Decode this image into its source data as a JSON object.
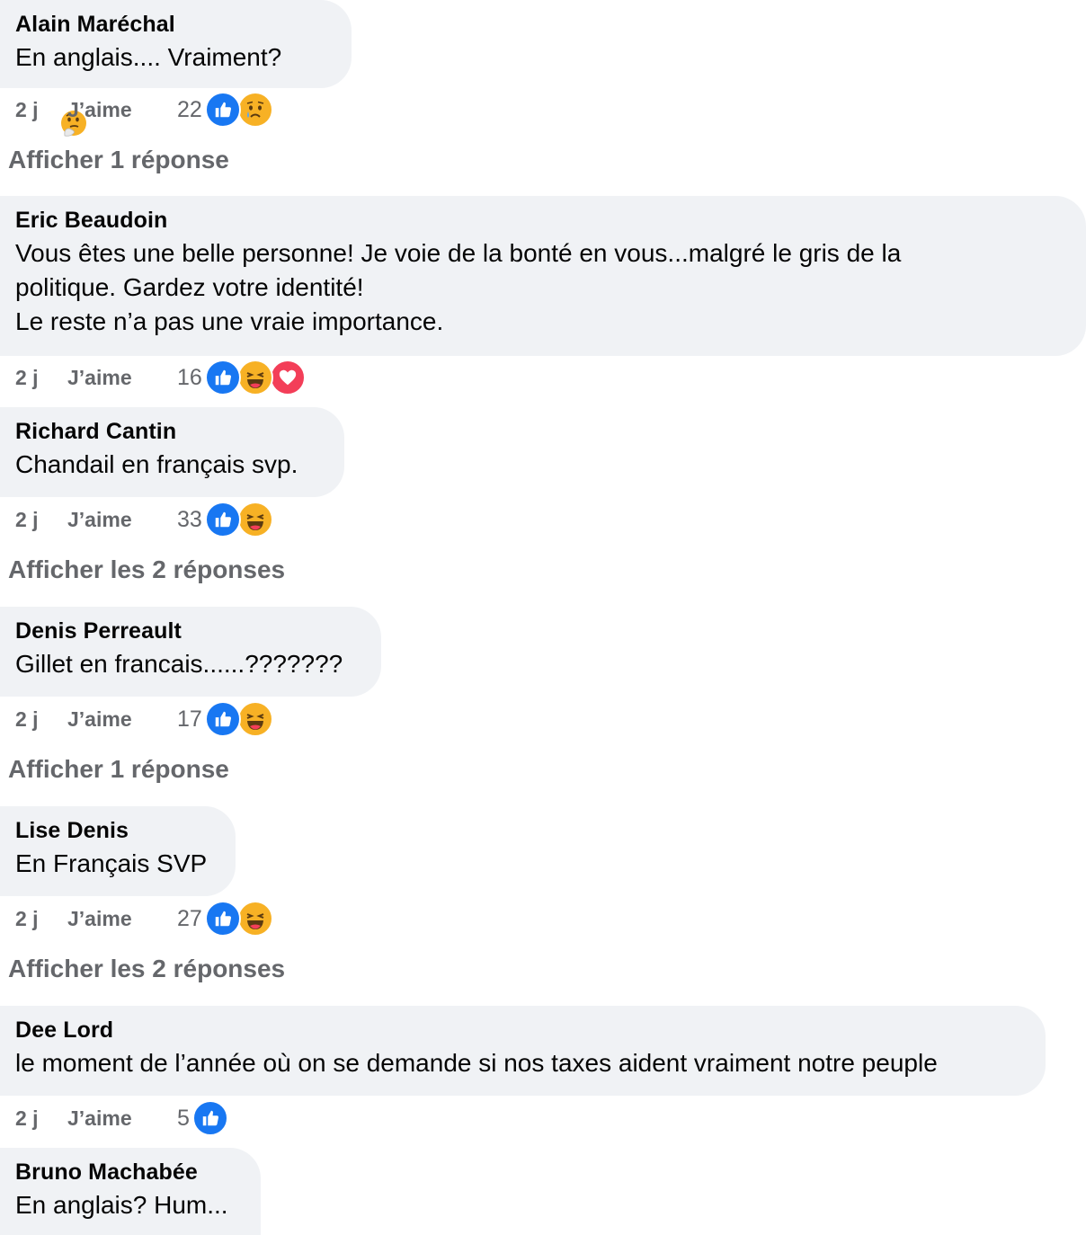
{
  "colors": {
    "bubble_bg": "#f0f2f5",
    "meta_text": "#65676b",
    "like_blue": "#1877f2",
    "haha_yellow": "#f7b125",
    "love_red": "#f33e58"
  },
  "comments": [
    {
      "author": "Alain Maréchal",
      "text": "En anglais.... Vraiment?",
      "text_emoji": "thinking-face-emoji",
      "time": "2 j",
      "like_label": "J’aime",
      "reaction_count": "22",
      "reactions": [
        "like",
        "sad"
      ],
      "replies_label": "Afficher 1 réponse"
    },
    {
      "author": "Eric Beaudoin",
      "text_lines": [
        "Vous êtes une belle personne! Je voie de la bonté en vous...malgré le gris de la",
        "politique. Gardez votre identité!",
        "Le reste n’a pas une vraie importance."
      ],
      "time": "2 j",
      "like_label": "J’aime",
      "reaction_count": "16",
      "reactions": [
        "like",
        "haha",
        "love"
      ]
    },
    {
      "author": "Richard Cantin",
      "text": "Chandail en français svp.",
      "time": "2 j",
      "like_label": "J’aime",
      "reaction_count": "33",
      "reactions": [
        "like",
        "haha"
      ],
      "replies_label": "Afficher les 2 réponses"
    },
    {
      "author": "Denis Perreault",
      "text": "Gillet en francais......???????",
      "time": "2 j",
      "like_label": "J’aime",
      "reaction_count": "17",
      "reactions": [
        "like",
        "haha"
      ],
      "replies_label": "Afficher 1 réponse"
    },
    {
      "author": "Lise Denis",
      "text": "En Français SVP",
      "time": "2 j",
      "like_label": "J’aime",
      "reaction_count": "27",
      "reactions": [
        "like",
        "haha"
      ],
      "replies_label": "Afficher les 2 réponses"
    },
    {
      "author": "Dee Lord",
      "text": "le moment de l’année où on se demande si nos taxes aident vraiment notre peuple",
      "time": "2 j",
      "like_label": "J’aime",
      "reaction_count": "5",
      "reactions": [
        "like"
      ]
    },
    {
      "author": "Bruno Machabée",
      "text": "En anglais? Hum..."
    }
  ]
}
